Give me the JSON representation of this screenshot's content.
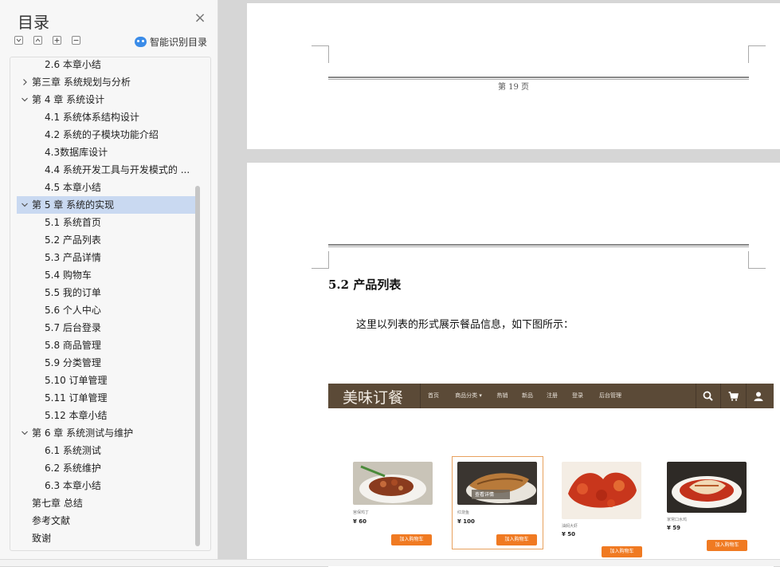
{
  "sidebar": {
    "title": "目录",
    "close_glyph": "×",
    "smart_toc_label": "智能识别目录",
    "tools": [
      "expand-all-icon",
      "collapse-icon",
      "add-level-icon",
      "remove-level-icon"
    ],
    "items": [
      {
        "label": "2.6 本章小结",
        "level": 2,
        "chevron": ""
      },
      {
        "label": "第三章 系统规划与分析",
        "level": 1,
        "chevron": "right"
      },
      {
        "label": "第 4 章 系统设计",
        "level": 1,
        "chevron": "down"
      },
      {
        "label": "4.1 系统体系结构设计",
        "level": 2,
        "chevron": ""
      },
      {
        "label": "4.2 系统的子模块功能介绍",
        "level": 2,
        "chevron": ""
      },
      {
        "label": "4.3数据库设计",
        "level": 2,
        "chevron": ""
      },
      {
        "label": "4.4 系统开发工具与开发模式的 ...",
        "level": 2,
        "chevron": ""
      },
      {
        "label": "4.5 本章小结",
        "level": 2,
        "chevron": ""
      },
      {
        "label": "第 5 章 系统的实现",
        "level": 1,
        "chevron": "down",
        "active": true
      },
      {
        "label": "5.1 系统首页",
        "level": 2,
        "chevron": ""
      },
      {
        "label": "5.2 产品列表",
        "level": 2,
        "chevron": ""
      },
      {
        "label": "5.3 产品详情",
        "level": 2,
        "chevron": ""
      },
      {
        "label": "5.4 购物车",
        "level": 2,
        "chevron": ""
      },
      {
        "label": "5.5 我的订单",
        "level": 2,
        "chevron": ""
      },
      {
        "label": "5.6 个人中心",
        "level": 2,
        "chevron": ""
      },
      {
        "label": "5.7 后台登录",
        "level": 2,
        "chevron": ""
      },
      {
        "label": "5.8 商品管理",
        "level": 2,
        "chevron": ""
      },
      {
        "label": "5.9 分类管理",
        "level": 2,
        "chevron": ""
      },
      {
        "label": "5.10 订单管理",
        "level": 2,
        "chevron": ""
      },
      {
        "label": "5.11 订单管理",
        "level": 2,
        "chevron": ""
      },
      {
        "label": "5.12 本章小结",
        "level": 2,
        "chevron": ""
      },
      {
        "label": "第 6 章 系统测试与维护",
        "level": 1,
        "chevron": "down"
      },
      {
        "label": "6.1 系统测试",
        "level": 2,
        "chevron": ""
      },
      {
        "label": "6.2 系统维护",
        "level": 2,
        "chevron": ""
      },
      {
        "label": "6.3 本章小结",
        "level": 2,
        "chevron": ""
      },
      {
        "label": "第七章 总结",
        "level": 1,
        "chevron": ""
      },
      {
        "label": "参考文献",
        "level": 1,
        "chevron": ""
      },
      {
        "label": "致谢",
        "level": 1,
        "chevron": ""
      }
    ]
  },
  "document": {
    "page_number_text": "第 19 页",
    "section_heading": "5.2 产品列表",
    "section_body": "这里以列表的形式展示餐品信息，如下图所示："
  },
  "site": {
    "brand": "美味订餐",
    "nav": [
      {
        "label": "首页"
      },
      {
        "label": "商品分类 ▾"
      },
      {
        "label": "热销",
        "active": true
      },
      {
        "label": "新品"
      },
      {
        "label": "注册"
      },
      {
        "label": "登录"
      },
      {
        "label": "后台管理"
      }
    ],
    "nav_icons": [
      "search-icon",
      "cart-icon",
      "user-icon"
    ],
    "products": [
      {
        "name": "宫保鸡丁",
        "price": "¥ 60",
        "button": "加入购物车"
      },
      {
        "name": "红烧鱼",
        "price": "¥ 100",
        "button": "加入购物车",
        "hover_label": "查看详情"
      },
      {
        "name": "油焖大虾",
        "price": "¥ 50",
        "button": "加入购物车"
      },
      {
        "name": "家常口水鸡",
        "price": "¥ 59",
        "button": "加入购物车"
      }
    ]
  }
}
